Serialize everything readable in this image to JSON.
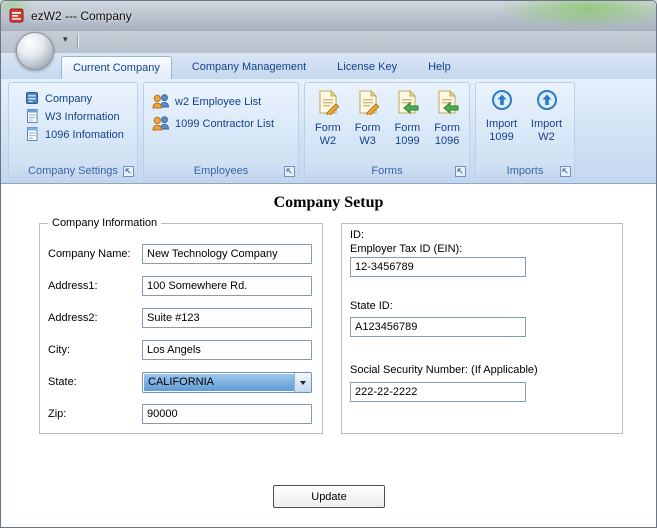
{
  "window": {
    "title": "ezW2 --- Company"
  },
  "tabs": [
    {
      "label": "Current Company",
      "active": true
    },
    {
      "label": "Company Management",
      "active": false
    },
    {
      "label": "License Key",
      "active": false
    },
    {
      "label": "Help",
      "active": false
    }
  ],
  "ribbon": {
    "company_settings": {
      "label": "Company Settings",
      "items": [
        {
          "label": "Company",
          "icon": "company-icon"
        },
        {
          "label": "W3 Information",
          "icon": "w3-form-icon"
        },
        {
          "label": "1096 Infomation",
          "icon": "form-1096-icon"
        }
      ]
    },
    "employees": {
      "label": "Employees",
      "items": [
        {
          "label": "w2 Employee List",
          "icon": "employee-list-icon"
        },
        {
          "label": "1099 Contractor List",
          "icon": "contractor-list-icon"
        }
      ]
    },
    "forms": {
      "label": "Forms",
      "items": [
        {
          "line1": "Form",
          "line2": "W2",
          "icon": "form-edit-icon"
        },
        {
          "line1": "Form",
          "line2": "W3",
          "icon": "form-edit-icon"
        },
        {
          "line1": "Form",
          "line2": "1099",
          "icon": "form-arrow-icon"
        },
        {
          "line1": "Form",
          "line2": "1096",
          "icon": "form-arrow-icon"
        }
      ]
    },
    "imports": {
      "label": "Imports",
      "items": [
        {
          "line1": "Import",
          "line2": "1099",
          "icon": "import-icon"
        },
        {
          "line1": "Import",
          "line2": "W2",
          "icon": "import-icon"
        }
      ]
    }
  },
  "main": {
    "title": "Company Setup",
    "company_info": {
      "legend": "Company Information",
      "company_name": {
        "label": "Company Name:",
        "value": "New Technology Company"
      },
      "address1": {
        "label": "Address1:",
        "value": "100 Somewhere Rd."
      },
      "address2": {
        "label": "Address2:",
        "value": "Suite #123"
      },
      "city": {
        "label": "City:",
        "value": "Los Angels"
      },
      "state": {
        "label": "State:",
        "value": "CALIFORNIA"
      },
      "zip": {
        "label": "Zip:",
        "value": "90000"
      }
    },
    "ids": {
      "caption": "ID:",
      "ein": {
        "label": "Employer Tax ID (EIN):",
        "value": "12-3456789"
      },
      "state_id": {
        "label": "State ID:",
        "value": "A123456789"
      },
      "ssn": {
        "label": "Social Security Number: (If Applicable)",
        "value": "222-22-2222"
      }
    },
    "update_label": "Update"
  },
  "colors": {
    "ribbon_text": "#15428b",
    "group_label_text": "#3a64a8",
    "state_highlight_top": "#9ec6ec",
    "state_highlight_bottom": "#5e9bd6",
    "app_icon_red": "#d63a2f",
    "desktop_glow_green": "#80c658"
  }
}
